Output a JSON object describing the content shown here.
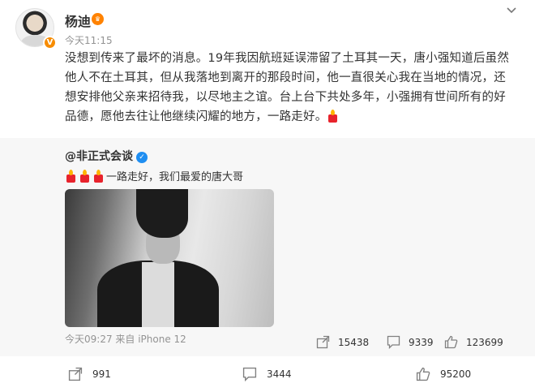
{
  "post": {
    "author": "杨迪",
    "time": "今天11:15",
    "text": "没想到传来了最坏的消息。19年我因航班延误滞留了土耳其一天，唐小强知道后虽然他人不在土耳其，但从我落地到离开的那段时间，他一直很关心我在当地的情况，还想安排他父亲来招待我，以尽地主之谊。台上台下共处多年，小强拥有世间所有的好品德，愿他去往让他继续闪耀的地方，一路走好。"
  },
  "repost": {
    "author": "@非正式会谈",
    "text": "一路走好，我们最爱的唐大哥",
    "meta": "今天09:27 来自 iPhone 12",
    "reposts": "15438",
    "comments": "9339",
    "likes": "123699"
  },
  "actions": {
    "reposts": "991",
    "comments": "3444",
    "likes": "95200"
  },
  "colors": {
    "accent": "#ff8200",
    "verified_blue": "#1f8ef1",
    "candle_red": "#e8232c"
  },
  "icons": [
    "chevron-down-icon",
    "verified-badge-icon",
    "candle-icon",
    "repost-icon",
    "comment-icon",
    "like-icon"
  ]
}
